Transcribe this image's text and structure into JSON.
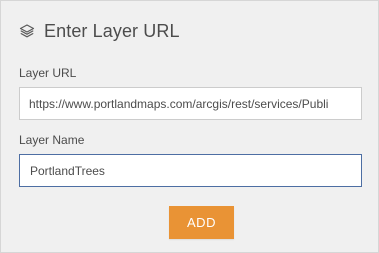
{
  "header": {
    "icon": "layers-icon",
    "title": "Enter Layer URL"
  },
  "form": {
    "url_label": "Layer URL",
    "url_value": "https://www.portlandmaps.com/arcgis/rest/services/Publi",
    "name_label": "Layer Name",
    "name_value": "PortlandTrees"
  },
  "actions": {
    "add_label": "ADD"
  },
  "colors": {
    "panel_background": "#f0f0f0",
    "accent_button": "#e99335",
    "focused_border": "#4d6ea3",
    "text": "#4c4c4c"
  }
}
